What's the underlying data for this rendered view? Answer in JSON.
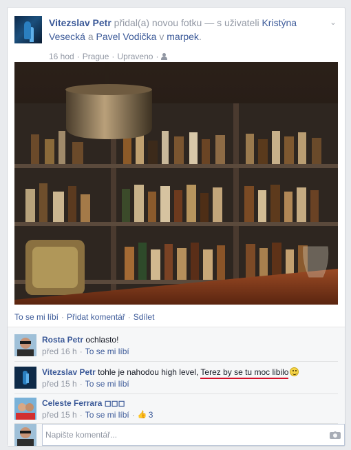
{
  "post": {
    "author": "Vitezslav Petr",
    "action": " přidal(a) novou fotku — s uživateli ",
    "tagged_1": "Kristýna Vesecká",
    "and": " a ",
    "tagged_2": "Pavel Vodička",
    "in": " v ",
    "place": "marpek",
    "period": ".",
    "time": "16 hod",
    "location": "Prague",
    "edited": "Upraveno",
    "sep": "·"
  },
  "actions": {
    "like": "To se mi líbí",
    "comment": "Přidat komentář",
    "share": "Sdílet",
    "sep": "·"
  },
  "comments": [
    {
      "author": "Rosta Petr",
      "text": "ochlasto!",
      "time": "před 16 h",
      "like": "To se mi líbí"
    },
    {
      "author": "Vitezslav Petr",
      "text_before": "tohle je nahodou high level, ",
      "text_highlight": "Terez by se tu moc libilo",
      "time": "před 15 h",
      "like": "To se mi líbí"
    },
    {
      "author": "Celeste Ferrara ◻◻◻",
      "time": "před 15 h",
      "like": "To se mi líbí",
      "likes_count": "3"
    }
  ],
  "composer": {
    "placeholder": "Napište komentář..."
  },
  "colors": {
    "link": "#3b5998",
    "meta": "#9197a3",
    "highlight_underline": "#d4102a"
  },
  "icons": [
    "chevron-down-icon",
    "audience-friends-icon",
    "thumbs-up-icon",
    "smiley-emoji-icon",
    "camera-icon"
  ]
}
